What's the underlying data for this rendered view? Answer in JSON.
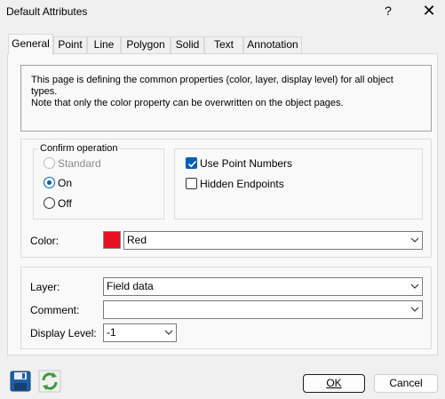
{
  "window": {
    "title": "Default Attributes",
    "help_glyph": "?",
    "close_glyph": "✕"
  },
  "tabs": [
    {
      "label": "General",
      "active": true
    },
    {
      "label": "Point"
    },
    {
      "label": "Line"
    },
    {
      "label": "Polygon"
    },
    {
      "label": "Solid"
    },
    {
      "label": "Text"
    },
    {
      "label": "Annotation"
    }
  ],
  "info": {
    "line1": "This page is defining the common properties (color, layer, display level) for all object types.",
    "line2": "Note that only the color property can be overwritten on the object pages."
  },
  "confirm": {
    "legend": "Confirm operation",
    "options": [
      {
        "label": "Standard",
        "enabled": false,
        "checked": false
      },
      {
        "label": "On",
        "enabled": true,
        "checked": true
      },
      {
        "label": "Off",
        "enabled": true,
        "checked": false
      }
    ]
  },
  "checks": {
    "use_point_numbers": {
      "label": "Use Point Numbers",
      "checked": true
    },
    "hidden_endpoints": {
      "label": "Hidden Endpoints",
      "checked": false
    }
  },
  "color": {
    "label": "Color:",
    "value": "Red",
    "swatch": "#e81123"
  },
  "layer": {
    "label": "Layer:",
    "value": "Field data"
  },
  "comment": {
    "label": "Comment:",
    "value": ""
  },
  "display_level": {
    "label": "Display Level:",
    "value": "-1"
  },
  "buttons": {
    "ok": "OK",
    "cancel": "Cancel"
  },
  "icons": {
    "save": "save-icon",
    "refresh": "refresh-icon"
  }
}
